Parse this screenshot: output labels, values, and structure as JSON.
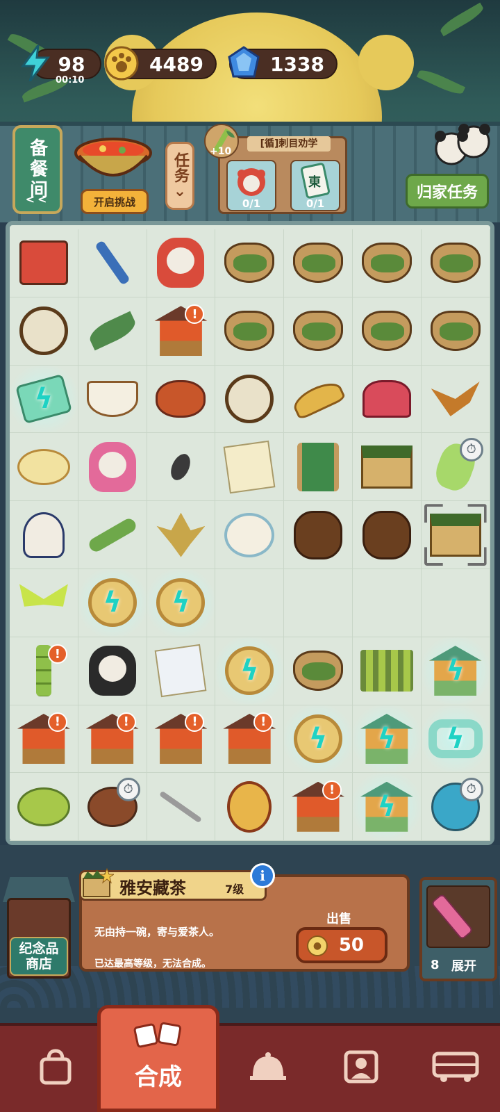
{
  "resources": {
    "energy": "98",
    "energy_timer": "00:10",
    "coins": "4489",
    "gems": "1338"
  },
  "header": {
    "side_tab_label": "备餐间",
    "side_tab_arrow": "<<",
    "challenge_button": "开启挑战",
    "task_button": "任务",
    "task_chevron": "⌄",
    "quest_title": "[循]刺目劝学",
    "quest_reward": "+10",
    "quest_slots": [
      "0/1",
      "0/1"
    ],
    "home_task": "归家任务"
  },
  "board": {
    "rows": 9,
    "cols": 7,
    "alert_symbol": "!",
    "clock_symbol": "⏱",
    "bolt_symbol": "ϟ"
  },
  "info_panel": {
    "item_name": "雅安藏茶",
    "item_level": "7级",
    "info_icon": "i",
    "description": "无由持一碗，寄与爱茶人。",
    "note": "已达最高等级，无法合成。",
    "sell_label": "出售",
    "sell_price": "50",
    "sell_coin_icon": "paw-coin-icon"
  },
  "shop": {
    "label_line1": "纪念品",
    "label_line2": "商店"
  },
  "storage": {
    "count": "8",
    "expand_label": "展开"
  },
  "nav": {
    "active_label": "合成",
    "items": [
      "bag-icon",
      "merge-icon",
      "cloche-icon",
      "profile-icon",
      "bus-icon"
    ]
  },
  "colors": {
    "board_bg": "#dde7dc",
    "accent_orange": "#e3654a",
    "nav_bg": "#7a2a2a",
    "glow": "#1fd2c4",
    "alert": "#e4602a"
  }
}
